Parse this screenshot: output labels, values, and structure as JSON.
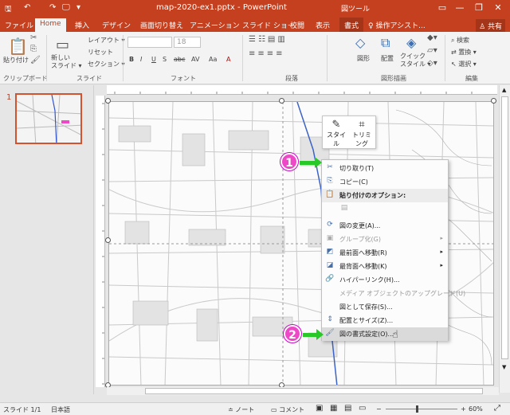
{
  "titlebar": {
    "title": "map-2020-ex1.pptx - PowerPoint",
    "tool_context": "図ツール",
    "qa_save": "🖫",
    "qa_undo": "↶",
    "qa_redo": "↷",
    "qa_present": "🖵",
    "qa_more": "▾",
    "minimize": "—",
    "restore": "❐",
    "close": "✕",
    "ribbon_toggle": "▭"
  },
  "tabs": [
    "ファイル",
    "Home",
    "挿入",
    "デザイン",
    "画面切り替え",
    "アニメーション",
    "スライド ショー",
    "校閲",
    "表示",
    "書式"
  ],
  "tell_me": "♀ 操作アシスト...",
  "share": "♙ 共有",
  "ribbon": {
    "paste": "貼り付け",
    "new_slide": "新しい\nスライド ▾",
    "layout": "レイアウト ▾",
    "reset": "リセット",
    "section": "セクション ▾",
    "font_size": "18",
    "font_buttons": [
      "B",
      "I",
      "U",
      "S",
      "abc",
      "AV",
      "Aa",
      "A"
    ],
    "shape": "図形",
    "arrange": "配置",
    "quick_style": "クイック\nスタイル ▾",
    "find": "検索",
    "replace": "置換 ▾",
    "select": "選択 ▾",
    "groups": [
      "クリップボード",
      "スライド",
      "フォント",
      "段落",
      "図形描画",
      "編集"
    ]
  },
  "slide_panel": {
    "number": "1"
  },
  "mini_toolbar": {
    "style": "スタイル",
    "crop": "トリミング"
  },
  "context_menu": [
    {
      "icon": "✂",
      "label": "切り取り(T)",
      "type": "item"
    },
    {
      "icon": "⎘",
      "label": "コピー(C)",
      "type": "item"
    },
    {
      "icon": "📋",
      "label": "貼り付けのオプション:",
      "type": "header"
    },
    {
      "icon": "▤",
      "label": "",
      "type": "disabled-icon"
    },
    {
      "icon": "⟳",
      "label": "図の変更(A)...",
      "type": "item"
    },
    {
      "icon": "▣",
      "label": "グループ化(G)",
      "type": "disabled",
      "arrow": "▸"
    },
    {
      "icon": "◩",
      "label": "最前面へ移動(R)",
      "type": "item",
      "arrow": "▸"
    },
    {
      "icon": "◪",
      "label": "最背面へ移動(K)",
      "type": "item",
      "arrow": "▸"
    },
    {
      "icon": "🔗",
      "label": "ハイパーリンク(H)...",
      "type": "item"
    },
    {
      "icon": "",
      "label": "メディア オブジェクトのアップグレード(U)",
      "type": "disabled"
    },
    {
      "icon": "",
      "label": "図として保存(S)...",
      "type": "item"
    },
    {
      "icon": "⇕",
      "label": "配置とサイズ(Z)...",
      "type": "item"
    },
    {
      "icon": "🖌",
      "label": "図の書式設定(O)...",
      "type": "highlight"
    }
  ],
  "annotations": {
    "badge1": "1",
    "badge2": "2"
  },
  "status": {
    "slide": "スライド 1/1",
    "lang": "日本語",
    "notes": "≐ ノート",
    "comments": "▭ コメント",
    "zoom_value": "60%",
    "zoom_minus": "−",
    "zoom_plus": "+"
  },
  "colors": {
    "accent": "#c4401f",
    "badge": "#ee48c8",
    "arrow": "#28c828"
  }
}
